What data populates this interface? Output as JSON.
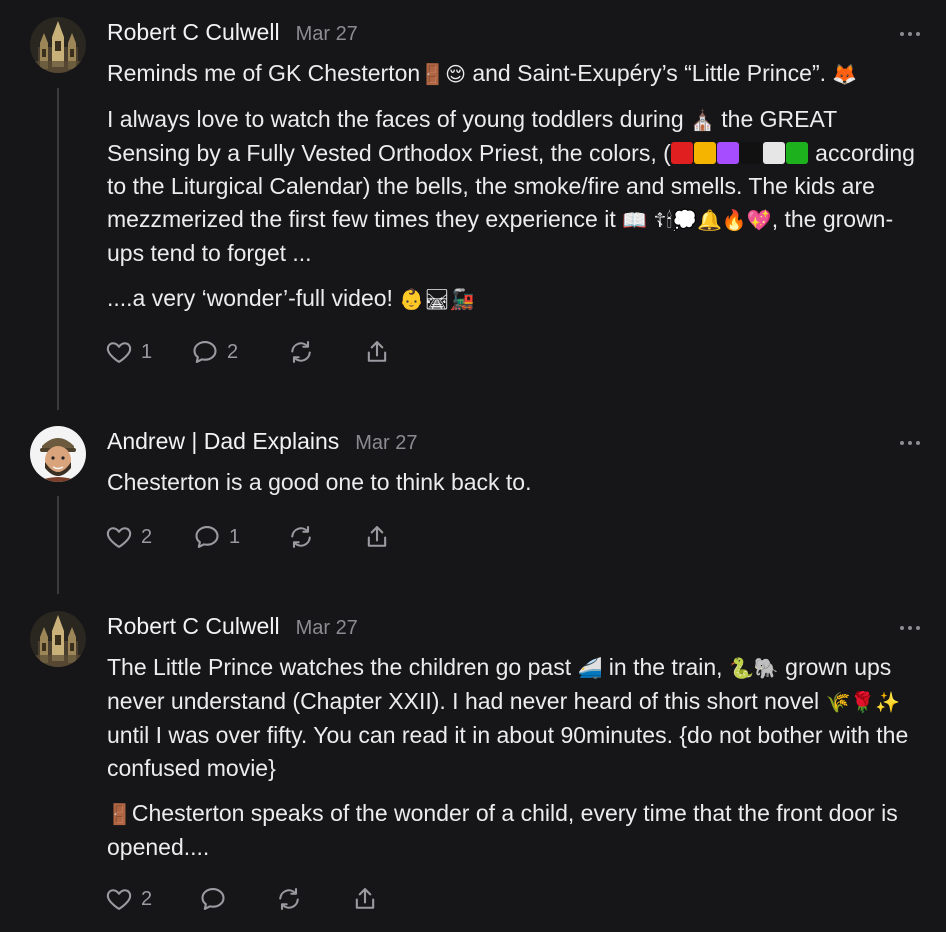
{
  "colors": {
    "background": "#161618",
    "text": "#ececee",
    "muted": "#8b8b91",
    "thread_line": "#3a3a3d",
    "liturgical": [
      "#e02020",
      "#f4b400",
      "#a64dff",
      "#111111",
      "#e6e6e6",
      "#1db21d"
    ]
  },
  "comments": [
    {
      "author": "Robert C Culwell",
      "date": "Mar 27",
      "avatar": "cathedral-avatar",
      "paragraphs": [
        {
          "parts": [
            "Reminds me of GK Chesterton",
            "🚪😌",
            " and Saint-Exupéry’s “Little Prince”. ",
            "🦊"
          ]
        },
        {
          "parts": [
            "I always love to watch the faces of young toddlers during ",
            "⛪",
            " the GREAT Sensing by a Fully Vested Orthodox Priest, the colors, (",
            "according to the Liturgical Calendar) the bells, the smoke/fire and smells. The kids are mezzmerized the first few times they experience it ",
            "📖 ☦🕯💭🔔🔥💖",
            ", the grown-ups tend to forget ..."
          ]
        },
        {
          "parts": [
            "....a very ‘wonder’-full video! ",
            "👶🛤🚂"
          ]
        }
      ],
      "likes": "1",
      "replies": "2"
    },
    {
      "author": "Andrew | Dad Explains",
      "date": "Mar 27",
      "avatar": "cartoon-man-avatar",
      "paragraphs": [
        {
          "parts": [
            "Chesterton is a good one to think back to."
          ]
        }
      ],
      "likes": "2",
      "replies": "1"
    },
    {
      "author": "Robert C Culwell",
      "date": "Mar 27",
      "avatar": "cathedral-avatar",
      "paragraphs": [
        {
          "parts": [
            "The Little Prince watches the children go past ",
            "🚄",
            " in the train, ",
            "🐍🐘",
            " grown ups never understand (Chapter XXII). I had never heard of this short novel ",
            "🌾🌹✨",
            " until I was over fifty. You can read it in about 90minutes. {do not bother with the confused movie}"
          ]
        },
        {
          "parts": [
            "🚪",
            "Chesterton speaks of the wonder of a child, every time that the front door is opened...."
          ]
        }
      ],
      "likes": "2",
      "replies": ""
    }
  ]
}
